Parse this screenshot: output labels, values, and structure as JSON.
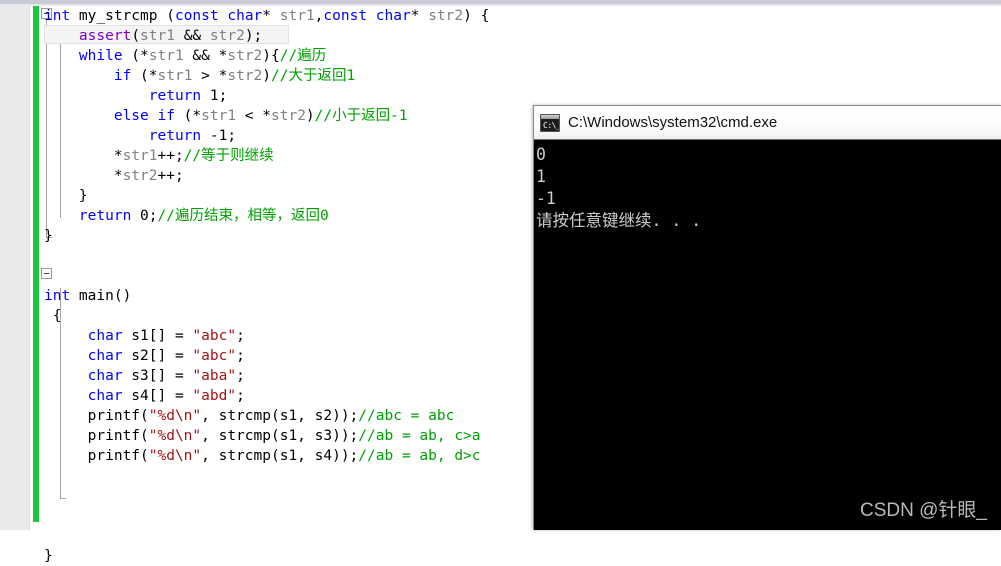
{
  "editor": {
    "name": "code-editor",
    "language": "C",
    "colors": {
      "keyword": "#0000ff",
      "identifier": "#808080",
      "string": "#a31515",
      "comment": "#00a000",
      "macro": "#8000c0",
      "change_bar": "#19c741",
      "background": "#ffffff",
      "gutter": "#e9eaec"
    },
    "lines": [
      {
        "indent": 0,
        "tokens": [
          {
            "t": "int ",
            "c": "kw"
          },
          {
            "t": "my_strcmp ",
            "c": "fn"
          },
          {
            "t": "(",
            "c": "num"
          },
          {
            "t": "const ",
            "c": "kw"
          },
          {
            "t": "char",
            "c": "kw"
          },
          {
            "t": "* ",
            "c": "num"
          },
          {
            "t": "str1",
            "c": "id"
          },
          {
            "t": ",",
            "c": "num"
          },
          {
            "t": "const ",
            "c": "kw"
          },
          {
            "t": "char",
            "c": "kw"
          },
          {
            "t": "* ",
            "c": "num"
          },
          {
            "t": "str2",
            "c": "id"
          },
          {
            "t": ") {",
            "c": "num"
          }
        ]
      },
      {
        "indent": 0,
        "tokens": [
          {
            "t": "    ",
            "c": "num"
          },
          {
            "t": "assert",
            "c": "macro"
          },
          {
            "t": "(",
            "c": "num"
          },
          {
            "t": "str1",
            "c": "id"
          },
          {
            "t": " && ",
            "c": "num"
          },
          {
            "t": "str2",
            "c": "id"
          },
          {
            "t": ");",
            "c": "num"
          }
        ]
      },
      {
        "indent": 0,
        "tokens": [
          {
            "t": "    ",
            "c": "num"
          },
          {
            "t": "while",
            "c": "kw"
          },
          {
            "t": " (*",
            "c": "num"
          },
          {
            "t": "str1",
            "c": "id"
          },
          {
            "t": " && *",
            "c": "num"
          },
          {
            "t": "str2",
            "c": "id"
          },
          {
            "t": "){",
            "c": "num"
          },
          {
            "t": "//遍历",
            "c": "cmt"
          }
        ]
      },
      {
        "indent": 0,
        "tokens": [
          {
            "t": "        ",
            "c": "num"
          },
          {
            "t": "if",
            "c": "kw"
          },
          {
            "t": " (*",
            "c": "num"
          },
          {
            "t": "str1",
            "c": "id"
          },
          {
            "t": " > *",
            "c": "num"
          },
          {
            "t": "str2",
            "c": "id"
          },
          {
            "t": ")",
            "c": "num"
          },
          {
            "t": "//大于返回1",
            "c": "cmt"
          }
        ]
      },
      {
        "indent": 0,
        "tokens": [
          {
            "t": "            ",
            "c": "num"
          },
          {
            "t": "return",
            "c": "kw"
          },
          {
            "t": " 1;",
            "c": "num"
          }
        ]
      },
      {
        "indent": 0,
        "tokens": [
          {
            "t": "        ",
            "c": "num"
          },
          {
            "t": "else if",
            "c": "kw"
          },
          {
            "t": " (*",
            "c": "num"
          },
          {
            "t": "str1",
            "c": "id"
          },
          {
            "t": " < *",
            "c": "num"
          },
          {
            "t": "str2",
            "c": "id"
          },
          {
            "t": ")",
            "c": "num"
          },
          {
            "t": "//小于返回-1",
            "c": "cmt"
          }
        ]
      },
      {
        "indent": 0,
        "tokens": [
          {
            "t": "            ",
            "c": "num"
          },
          {
            "t": "return",
            "c": "kw"
          },
          {
            "t": " -1;",
            "c": "num"
          }
        ]
      },
      {
        "indent": 0,
        "tokens": [
          {
            "t": "        *",
            "c": "num"
          },
          {
            "t": "str1",
            "c": "id"
          },
          {
            "t": "++;",
            "c": "num"
          },
          {
            "t": "//等于则继续",
            "c": "cmt"
          }
        ]
      },
      {
        "indent": 0,
        "tokens": [
          {
            "t": "        *",
            "c": "num"
          },
          {
            "t": "str2",
            "c": "id"
          },
          {
            "t": "++;",
            "c": "num"
          }
        ]
      },
      {
        "indent": 0,
        "tokens": [
          {
            "t": "    }",
            "c": "num"
          }
        ]
      },
      {
        "indent": 0,
        "tokens": [
          {
            "t": "    ",
            "c": "num"
          },
          {
            "t": "return",
            "c": "kw"
          },
          {
            "t": " 0;",
            "c": "num"
          },
          {
            "t": "//遍历结束，相等，返回0",
            "c": "cmt"
          }
        ]
      },
      {
        "indent": 0,
        "tokens": [
          {
            "t": "}",
            "c": "num"
          }
        ]
      },
      {
        "indent": 0,
        "tokens": [
          {
            "t": "",
            "c": "num"
          }
        ]
      },
      {
        "indent": 0,
        "tokens": [
          {
            "t": "",
            "c": "num"
          }
        ]
      },
      {
        "indent": 0,
        "tokens": [
          {
            "t": "int ",
            "c": "kw"
          },
          {
            "t": "main",
            "c": "fn"
          },
          {
            "t": "()",
            "c": "num"
          }
        ]
      },
      {
        "indent": 0,
        "tokens": [
          {
            "t": " {",
            "c": "num"
          }
        ]
      },
      {
        "indent": 0,
        "tokens": [
          {
            "t": "     ",
            "c": "num"
          },
          {
            "t": "char",
            "c": "kw"
          },
          {
            "t": " s1[] = ",
            "c": "num"
          },
          {
            "t": "\"abc\"",
            "c": "str"
          },
          {
            "t": ";",
            "c": "num"
          }
        ]
      },
      {
        "indent": 0,
        "tokens": [
          {
            "t": "     ",
            "c": "num"
          },
          {
            "t": "char",
            "c": "kw"
          },
          {
            "t": " s2[] = ",
            "c": "num"
          },
          {
            "t": "\"abc\"",
            "c": "str"
          },
          {
            "t": ";",
            "c": "num"
          }
        ]
      },
      {
        "indent": 0,
        "tokens": [
          {
            "t": "     ",
            "c": "num"
          },
          {
            "t": "char",
            "c": "kw"
          },
          {
            "t": " s3[] = ",
            "c": "num"
          },
          {
            "t": "\"aba\"",
            "c": "str"
          },
          {
            "t": ";",
            "c": "num"
          }
        ]
      },
      {
        "indent": 0,
        "tokens": [
          {
            "t": "     ",
            "c": "num"
          },
          {
            "t": "char",
            "c": "kw"
          },
          {
            "t": " s4[] = ",
            "c": "num"
          },
          {
            "t": "\"abd\"",
            "c": "str"
          },
          {
            "t": ";",
            "c": "num"
          }
        ]
      },
      {
        "indent": 0,
        "tokens": [
          {
            "t": "     printf(",
            "c": "num"
          },
          {
            "t": "\"%d\\n\"",
            "c": "str"
          },
          {
            "t": ", strcmp(s1, s2));",
            "c": "num"
          },
          {
            "t": "//abc = abc",
            "c": "cmt"
          }
        ]
      },
      {
        "indent": 0,
        "tokens": [
          {
            "t": "     printf(",
            "c": "num"
          },
          {
            "t": "\"%d\\n\"",
            "c": "str"
          },
          {
            "t": ", strcmp(s1, s3));",
            "c": "num"
          },
          {
            "t": "//ab = ab, c>a",
            "c": "cmt"
          }
        ]
      },
      {
        "indent": 0,
        "tokens": [
          {
            "t": "     printf(",
            "c": "num"
          },
          {
            "t": "\"%d\\n\"",
            "c": "str"
          },
          {
            "t": ", strcmp(s1, s4));",
            "c": "num"
          },
          {
            "t": "//ab = ab, d>c",
            "c": "cmt"
          }
        ]
      },
      {
        "indent": 0,
        "tokens": [
          {
            "t": "",
            "c": "num"
          }
        ]
      },
      {
        "indent": 0,
        "tokens": [
          {
            "t": "",
            "c": "num"
          }
        ]
      },
      {
        "indent": 0,
        "tokens": [
          {
            "t": "",
            "c": "num"
          }
        ]
      },
      {
        "indent": 0,
        "tokens": [
          {
            "t": "",
            "c": "num"
          }
        ]
      },
      {
        "indent": 0,
        "tokens": [
          {
            "t": "}",
            "c": "num"
          }
        ]
      }
    ]
  },
  "console": {
    "title": "C:\\Windows\\system32\\cmd.exe",
    "icon": "cmd-terminal-icon",
    "icon_prompt": "C:\\_",
    "output": [
      "0",
      "1",
      "-1",
      "请按任意键继续. . ."
    ],
    "background": "#000000",
    "text_color": "#cccccc"
  },
  "watermark": {
    "text": "CSDN @针眼_"
  }
}
